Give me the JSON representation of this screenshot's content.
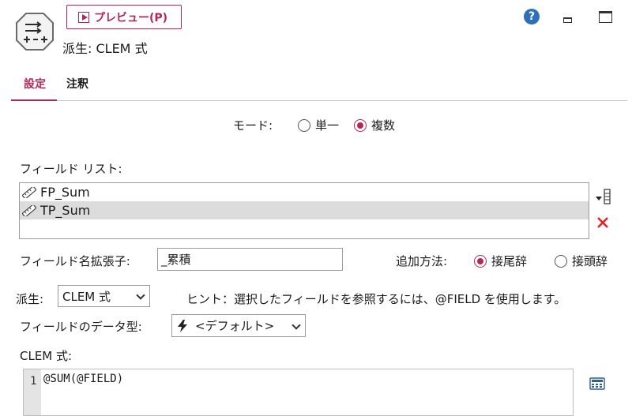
{
  "header": {
    "preview_label": "プレビュー(P)",
    "node_title": "派生: CLEM 式",
    "help_glyph": "?"
  },
  "tabs": [
    "設定",
    "注釈"
  ],
  "mode": {
    "label": "モード:",
    "options": [
      "単一",
      "複数"
    ],
    "selected": "複数"
  },
  "field_list": {
    "label": "フィールド リスト:",
    "items": [
      "FP_Sum",
      "TP_Sum"
    ],
    "selected": "TP_Sum"
  },
  "extension": {
    "label": "フィールド名拡張子:",
    "value": "_累積"
  },
  "add_method": {
    "label": "追加方法:",
    "options": [
      "接尾辞",
      "接頭辞"
    ],
    "selected": "接尾辞"
  },
  "derive": {
    "label": "派生:",
    "value": "CLEM 式",
    "hint": "ヒント：選択したフィールドを参照するには、@FIELD を使用します。"
  },
  "data_type": {
    "label": "フィールドのデータ型:",
    "value": "<デフォルト>"
  },
  "clem": {
    "label": "CLEM 式:",
    "line_number": "1",
    "code": "@SUM(@FIELD)"
  },
  "colors": {
    "accent": "#b0285a",
    "help": "#2e6fba",
    "delete": "#e0262b",
    "selected_row": "#dcdcdc"
  }
}
